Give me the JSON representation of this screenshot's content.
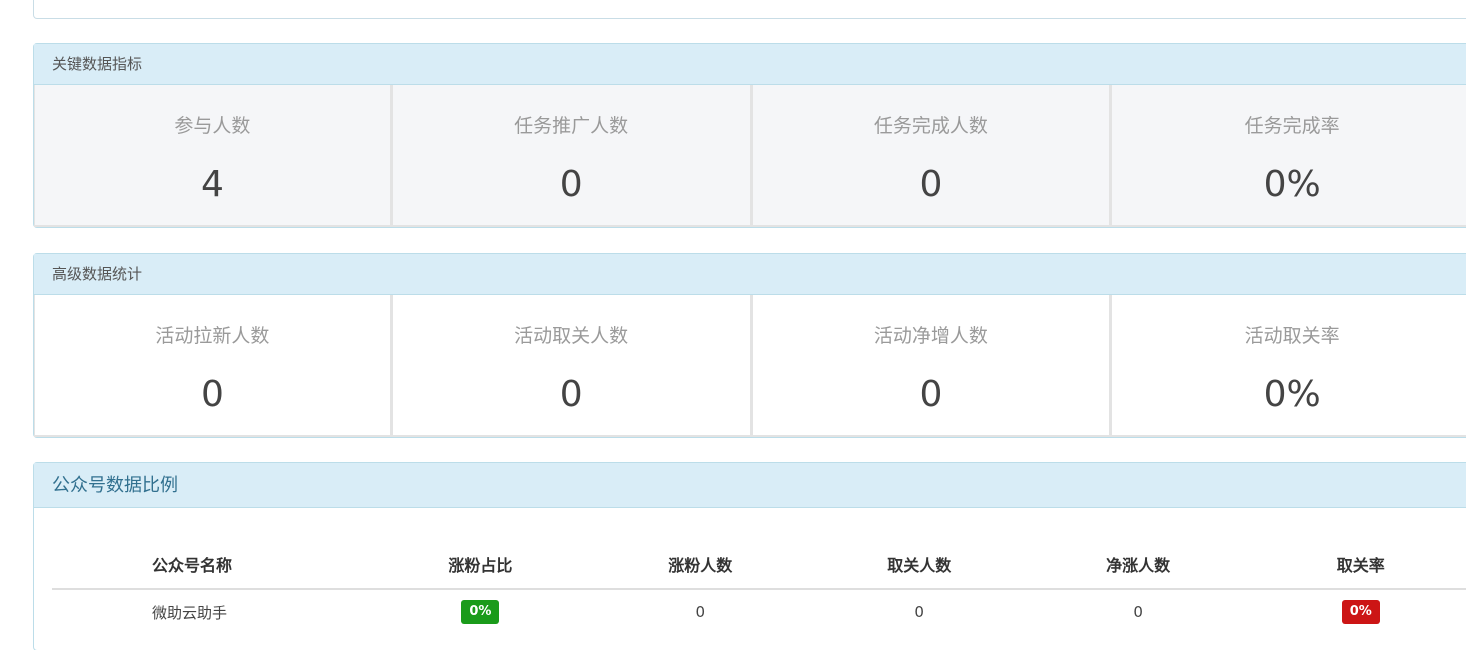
{
  "key_metrics": {
    "title": "关键数据指标",
    "items": [
      {
        "label": "参与人数",
        "value": "4"
      },
      {
        "label": "任务推广人数",
        "value": "0"
      },
      {
        "label": "任务完成人数",
        "value": "0"
      },
      {
        "label": "任务完成率",
        "value": "0%"
      }
    ]
  },
  "advanced_stats": {
    "title": "高级数据统计",
    "items": [
      {
        "label": "活动拉新人数",
        "value": "0"
      },
      {
        "label": "活动取关人数",
        "value": "0"
      },
      {
        "label": "活动净增人数",
        "value": "0"
      },
      {
        "label": "活动取关率",
        "value": "0%"
      }
    ]
  },
  "account_ratio": {
    "title": "公众号数据比例",
    "columns": [
      "公众号名称",
      "涨粉占比",
      "涨粉人数",
      "取关人数",
      "净涨人数",
      "取关率"
    ],
    "rows": [
      {
        "name": "微助云助手",
        "fan_ratio": "0%",
        "fans": "0",
        "unfollow": "0",
        "net": "0",
        "unfollow_rate": "0%"
      }
    ]
  },
  "colors": {
    "heading_bg": "#d9edf7",
    "badge_green": "#1a9b1a",
    "badge_red": "#cc1515"
  }
}
